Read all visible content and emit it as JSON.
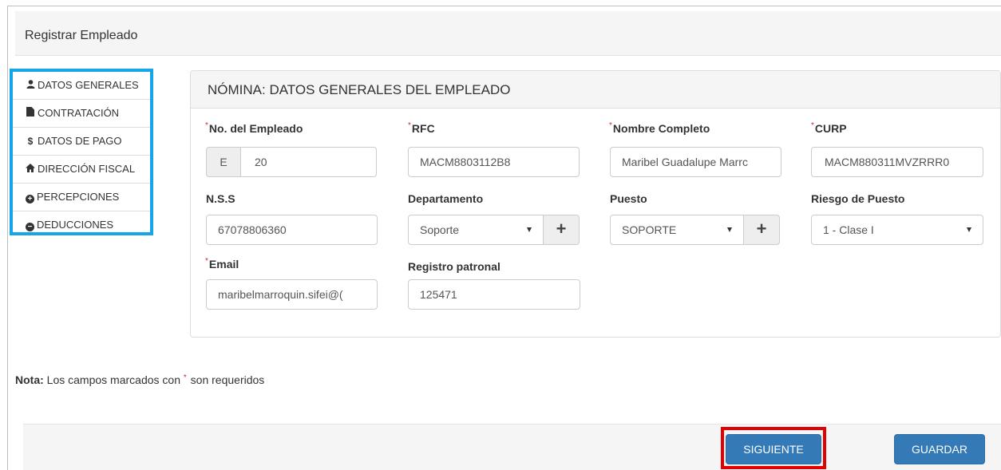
{
  "header": {
    "title": "Registrar Empleado"
  },
  "nav": [
    {
      "icon": "user-icon",
      "label": "DATOS GENERALES"
    },
    {
      "icon": "file-icon",
      "label": "CONTRATACIÓN"
    },
    {
      "icon": "dollar-icon",
      "label": "DATOS DE PAGO"
    },
    {
      "icon": "home-icon",
      "label": "DIRECCIÓN FISCAL"
    },
    {
      "icon": "plus-circle-icon",
      "label": "PERCEPCIONES"
    },
    {
      "icon": "minus-circle-icon",
      "label": "DEDUCCIONES"
    }
  ],
  "panel": {
    "title": "NÓMINA: DATOS GENERALES DEL EMPLEADO"
  },
  "form": {
    "required_mark": "*",
    "no_empleado": {
      "label": "No. del Empleado",
      "prefix": "E",
      "value": "20"
    },
    "rfc": {
      "label": "RFC",
      "value": "MACM8803112B8"
    },
    "nombre": {
      "label": "Nombre Completo",
      "value": "Maribel Guadalupe Marrc"
    },
    "curp": {
      "label": "CURP",
      "value": "MACM880311MVZRRR0"
    },
    "nss": {
      "label": "N.S.S",
      "value": "67078806360"
    },
    "departamento": {
      "label": "Departamento",
      "value": "Soporte"
    },
    "puesto": {
      "label": "Puesto",
      "value": "SOPORTE"
    },
    "riesgo": {
      "label": "Riesgo de Puesto",
      "value": "1 - Clase I"
    },
    "email": {
      "label": "Email",
      "value": "maribelmarroquin.sifei@("
    },
    "registro": {
      "label": "Registro patronal",
      "value": "125471"
    },
    "plus_symbol": "+"
  },
  "note": {
    "bold": "Nota:",
    "text_before": " Los campos marcados con ",
    "mark": "*",
    "text_after": " son requeridos"
  },
  "buttons": {
    "next": "SIGUIENTE",
    "save": "GUARDAR"
  },
  "colors": {
    "primary": "#337ab7",
    "nav_highlight": "#14a6e8",
    "button_highlight": "#e20000",
    "required": "#c9302c"
  }
}
